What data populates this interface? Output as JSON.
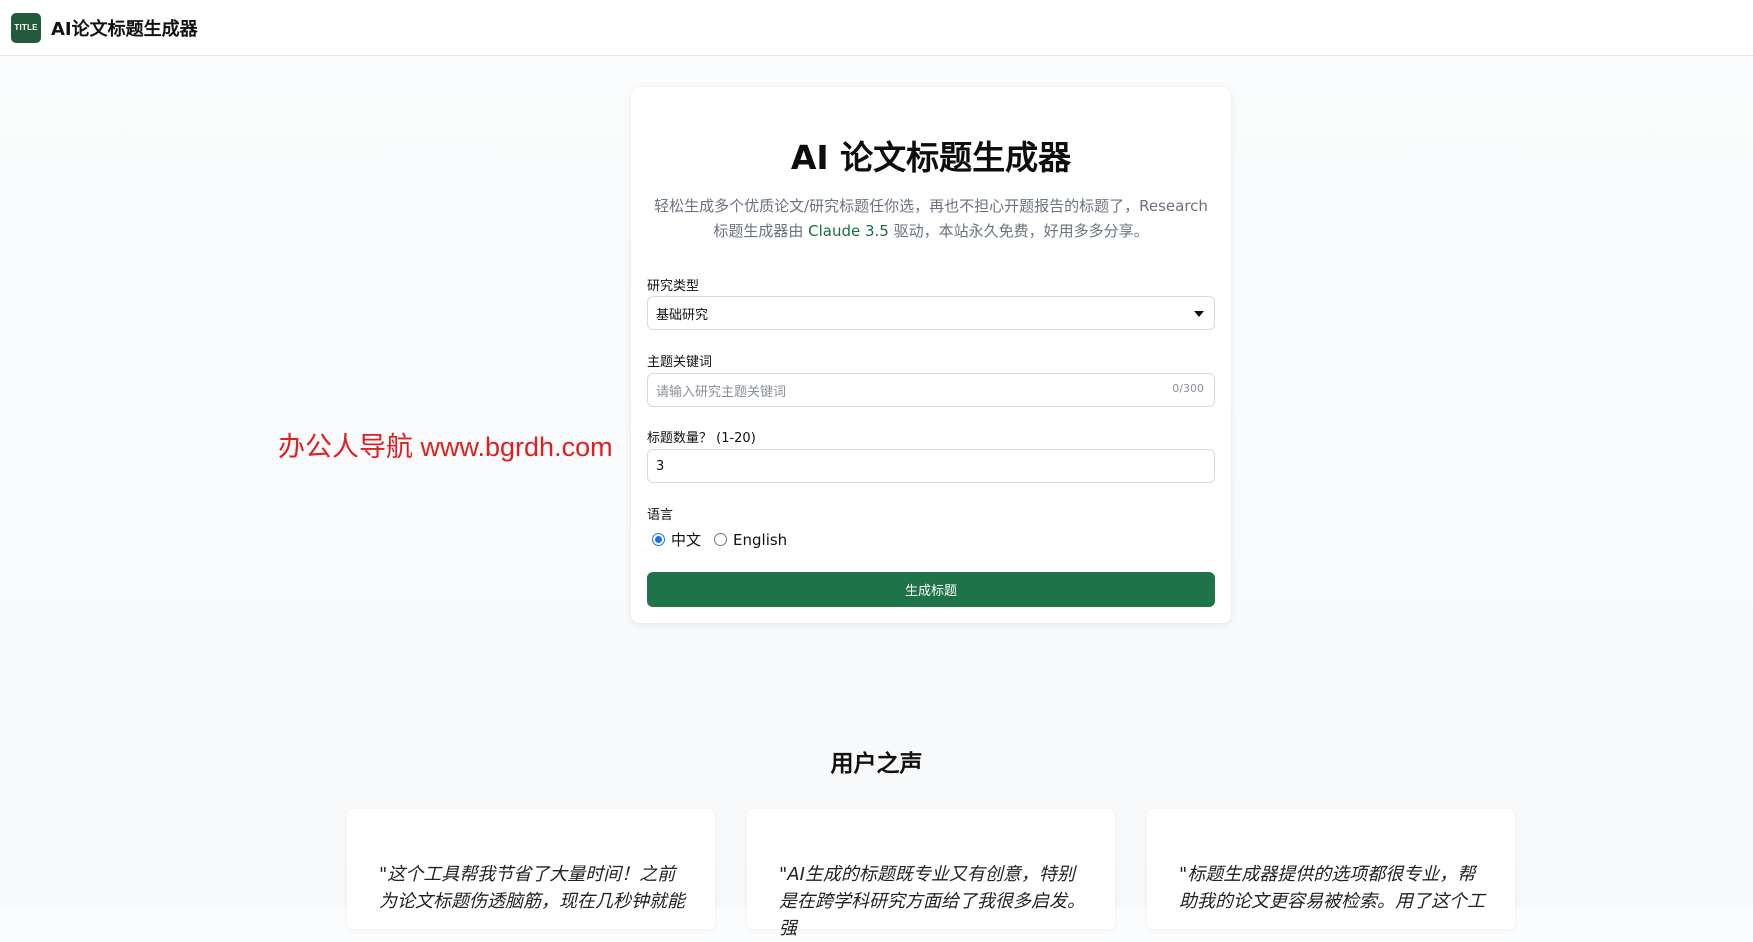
{
  "header": {
    "logo_text": "TITLE",
    "brand": "AI论文标题生成器"
  },
  "form": {
    "title": "AI 论文标题生成器",
    "desc_part1": "轻松生成多个优质论文/研究标题任你选，再也不担心开题报告的标题了，Research标题生成器由 ",
    "desc_accent": "Claude 3.5",
    "desc_part2": " 驱动，本站永久免费，好用多多分享。",
    "research_type_label": "研究类型",
    "research_type_value": "基础研究",
    "keywords_label": "主题关键词",
    "keywords_placeholder": "请输入研究主题关键词",
    "keywords_counter": "0/300",
    "count_label": "标题数量？ (1-20)",
    "count_value": "3",
    "language_label": "语言",
    "language_options": [
      "中文",
      "English"
    ],
    "language_selected": "中文",
    "submit_label": "生成标题"
  },
  "watermark": "办公人导航  www.bgrdh.com",
  "testimonials": {
    "title": "用户之声",
    "items": [
      {
        "quote": "\"这个工具帮我节省了大量时间！之前为论文标题伤透脑筋，现在几秒钟就能"
      },
      {
        "quote": "\"AI生成的标题既专业又有创意，特别是在跨学科研究方面给了我很多启发。强"
      },
      {
        "quote": "\"标题生成器提供的选项都很专业，帮助我的论文更容易被检索。用了这个工"
      }
    ]
  },
  "colors": {
    "brand_green": "#1e7349",
    "logo_green": "#245a3c",
    "radio_blue": "#1a73e8",
    "watermark_red": "#e02020"
  }
}
